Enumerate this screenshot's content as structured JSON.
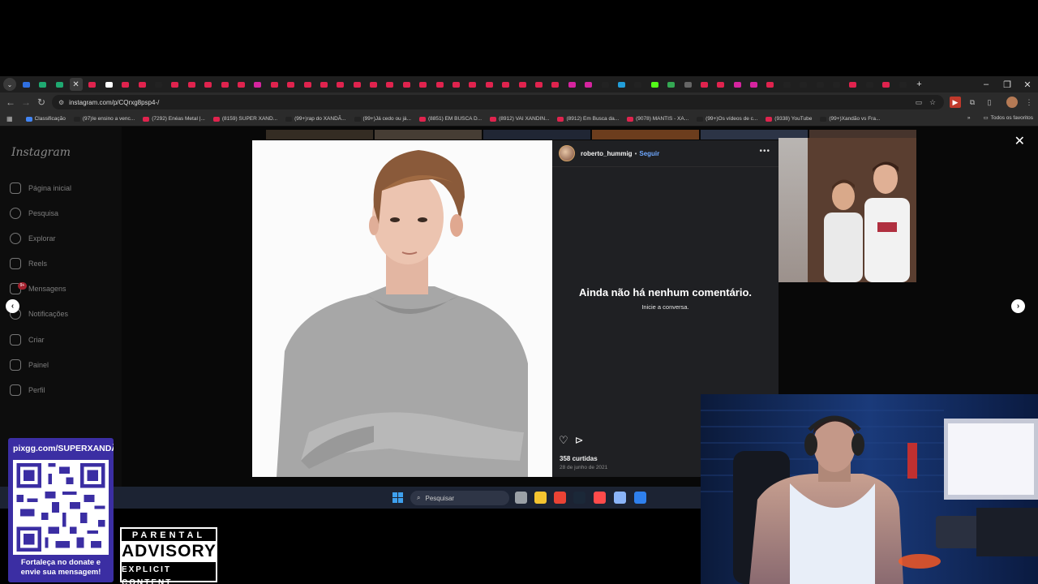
{
  "browser": {
    "tab_icon_colors": [
      "#2f6fe0",
      "#1fa971",
      "#1fa971",
      "close",
      "#e0234e",
      "#ffffff",
      "#e0234e",
      "#e0234e",
      "#222222",
      "#e0234e",
      "#e0234e",
      "#e0234e",
      "#e0234e",
      "#e0234e",
      "#d6249f",
      "#e0234e",
      "#e0234e",
      "#e0234e",
      "#e0234e",
      "#e0234e",
      "#e0234e",
      "#e0234e",
      "#e0234e",
      "#e0234e",
      "#e0234e",
      "#e0234e",
      "#e0234e",
      "#e0234e",
      "#e0234e",
      "#e0234e",
      "#e0234e",
      "#e0234e",
      "#e0234e",
      "#d6249f",
      "#d6249f",
      "#222222",
      "#229ed9",
      "#222222",
      "#53fc18",
      "#34a853",
      "#666666",
      "#e0234e",
      "#e0234e",
      "#d6249f",
      "#d6249f",
      "#e0234e",
      "#222222",
      "#222222",
      "#222222",
      "#222222",
      "#e0234e",
      "#222222",
      "#e0234e",
      "#222222"
    ],
    "new_tab": "+",
    "window_controls": {
      "minimize": "–",
      "maximize": "❐",
      "close": "✕"
    },
    "url": "instagram.com/p/CQrxg8psp4-/",
    "bookmarks": [
      {
        "label": "Classificação",
        "color": "#4285f4"
      },
      {
        "label": "(97)Ie ensino a venc...",
        "color": "#222222"
      },
      {
        "label": "(7292) Enéas Metal |...",
        "color": "#e0234e"
      },
      {
        "label": "(8159) SUPER XAND...",
        "color": "#e0234e"
      },
      {
        "label": "(99+)rap do XANDÃ...",
        "color": "#222222"
      },
      {
        "label": "(99+)Já cedo ou já...",
        "color": "#222222"
      },
      {
        "label": "(8851) EM BUSCA D...",
        "color": "#e0234e"
      },
      {
        "label": "(8912) VAI XANDIN...",
        "color": "#e0234e"
      },
      {
        "label": "(8912) Em Busca da...",
        "color": "#e0234e"
      },
      {
        "label": "(9078) MANTIS - XA...",
        "color": "#e0234e"
      },
      {
        "label": "(99+)Os vídeos de c...",
        "color": "#222222"
      },
      {
        "label": "(9338) YouTube",
        "color": "#e0234e"
      },
      {
        "label": "(99+)Xandão vs Fra...",
        "color": "#222222"
      }
    ],
    "bookmarks_overflow": "»",
    "all_favorites": "Todos os favoritos"
  },
  "instagram": {
    "logo": "Instagram",
    "nav": [
      {
        "label": "Página inicial",
        "icon": "home-icon"
      },
      {
        "label": "Pesquisa",
        "icon": "search-icon"
      },
      {
        "label": "Explorar",
        "icon": "compass-icon"
      },
      {
        "label": "Reels",
        "icon": "reels-icon"
      },
      {
        "label": "Mensagens",
        "icon": "messenger-icon"
      },
      {
        "label": "Notificações",
        "icon": "heart-icon"
      },
      {
        "label": "Criar",
        "icon": "plus-icon"
      },
      {
        "label": "Painel",
        "icon": "chart-icon"
      },
      {
        "label": "Perfil",
        "icon": "profile-icon"
      }
    ],
    "messages_badge": "9+",
    "post": {
      "author": "roberto_hummig",
      "separator": "•",
      "follow": "Seguir",
      "more": "•••",
      "no_comments_title": "Ainda não há nenhum comentário.",
      "no_comments_sub": "Inicie a conversa.",
      "likes": "358 curtidas",
      "date": "28 de junho de 2021"
    },
    "close": "✕",
    "prev": "‹",
    "next": "›"
  },
  "taskbar": {
    "search_placeholder": "Pesquisar",
    "apps": [
      "#9aa0a6",
      "#f4c430",
      "#ea4335",
      "#1b2838",
      "#ff4b4b",
      "#8ab4f8",
      "#2f80ed"
    ]
  },
  "overlay": {
    "pix_url": "pixgg.com/SUPERXANDÃ",
    "pix_message_1": "Fortaleça no donate e",
    "pix_message_2": "envie sua mensagem!",
    "advisory_top": "PARENTAL",
    "advisory_mid": "ADVISORY",
    "advisory_bottom": "EXPLICIT CONTENT"
  }
}
